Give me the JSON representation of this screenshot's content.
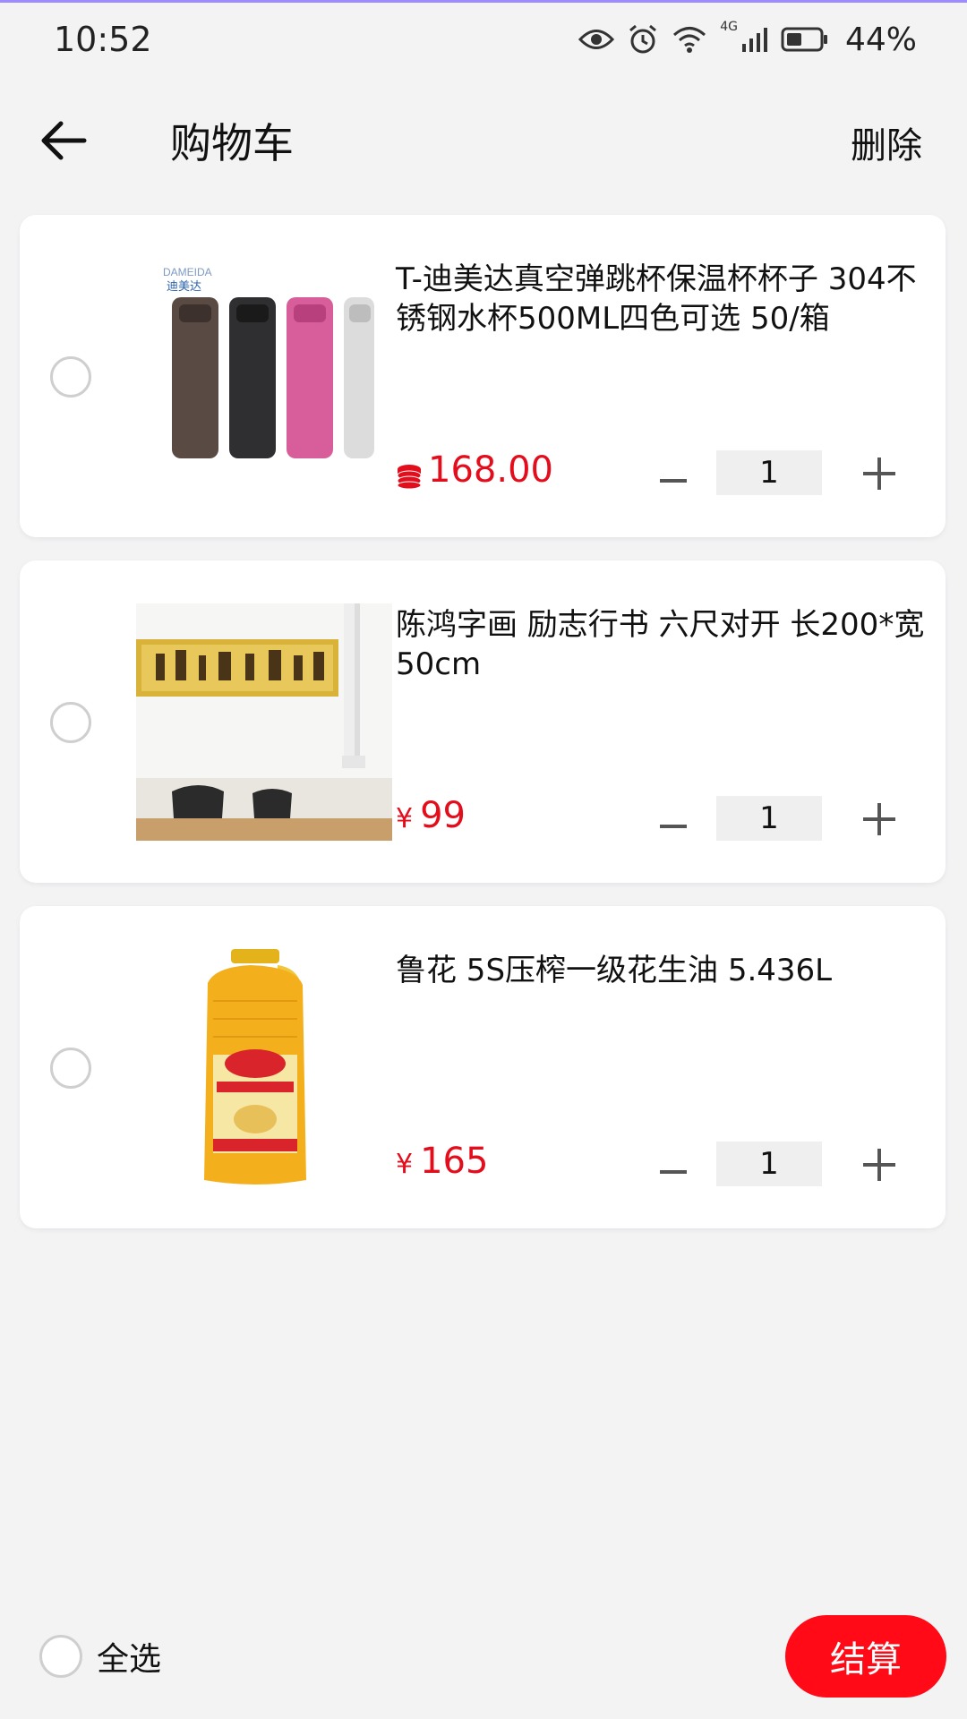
{
  "status_bar": {
    "time": "10:52",
    "network": "4G",
    "battery_percent": "44%",
    "icons": [
      "eye-icon",
      "alarm-icon",
      "wifi-icon",
      "signal-icon",
      "battery-icon"
    ]
  },
  "header": {
    "title": "购物车",
    "delete_label": "删除"
  },
  "cart": {
    "items": [
      {
        "title": "T-迪美达真空弹跳杯保温杯杯子 304不锈钢水杯500ML四色可选 50/箱",
        "price": "168.00",
        "currency_icon": "coin-icon",
        "quantity": "1",
        "image_brand": "DAMEIDA",
        "image_brand_cn": "迪美达"
      },
      {
        "title": "陈鸿字画 励志行书 六尺对开 长200*宽50cm",
        "currency": "¥",
        "price": "99",
        "quantity": "1"
      },
      {
        "title": "鲁花  5S压榨一级花生油 5.436L",
        "currency": "¥",
        "price": "165",
        "quantity": "1"
      }
    ]
  },
  "footer": {
    "select_all_label": "全选",
    "checkout_label": "结算"
  },
  "colors": {
    "accent_red": "#e30d1c",
    "checkout_red": "#ff0a16",
    "background": "#f3f3f4"
  }
}
